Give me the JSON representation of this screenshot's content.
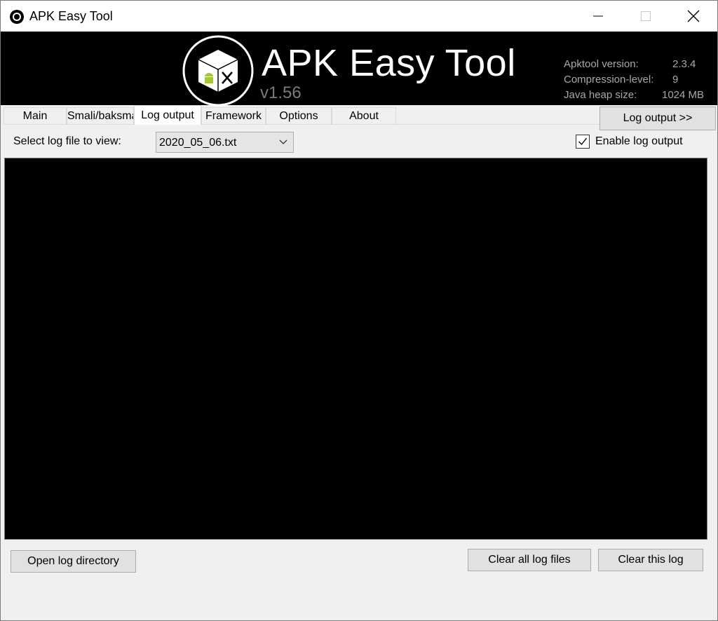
{
  "window": {
    "title": "APK Easy Tool"
  },
  "banner": {
    "title": "APK Easy Tool",
    "version": "v1.56",
    "info": [
      {
        "label": "Apktool version:",
        "value": "2.3.4"
      },
      {
        "label": "Compression-level:",
        "value": "9"
      },
      {
        "label": "Java heap size:",
        "value": "1024 MB"
      }
    ]
  },
  "tabs": [
    {
      "label": "Main"
    },
    {
      "label": "Smali/baksmali"
    },
    {
      "label": "Log output"
    },
    {
      "label": "Framework"
    },
    {
      "label": "Options"
    },
    {
      "label": "About"
    }
  ],
  "active_tab": "Log output",
  "log_toggle_label": "Log output >>",
  "log_panel": {
    "select_label": "Select log file to view:",
    "selected_file": "2020_05_06.txt",
    "enable_label": "Enable log output",
    "enable_checked": true
  },
  "buttons": {
    "open_dir": "Open log directory",
    "clear_all": "Clear all log files",
    "clear_this": "Clear this log"
  },
  "icons": {
    "app": "app-logo-icon",
    "minimize": "minimize-icon",
    "maximize": "maximize-icon",
    "close": "close-icon",
    "dropdown": "chevron-down-icon",
    "check": "check-icon"
  }
}
